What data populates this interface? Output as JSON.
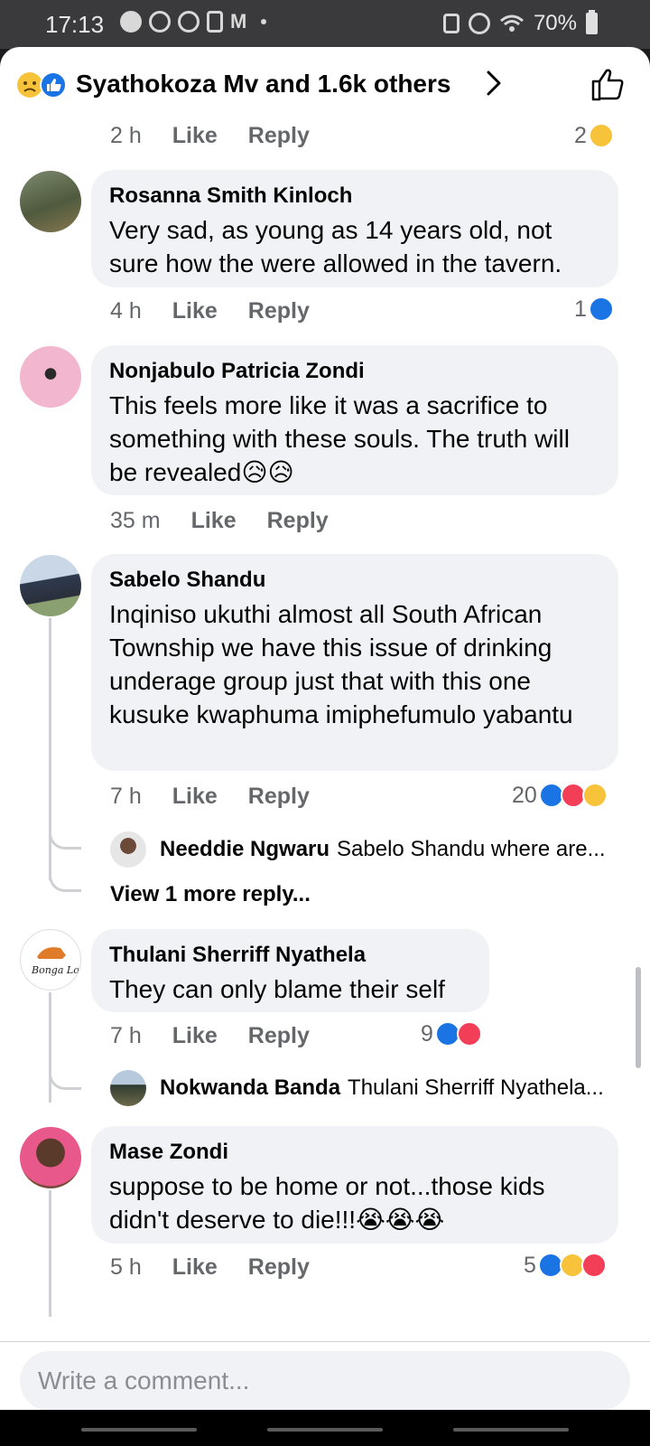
{
  "status_bar": {
    "time": "17:13",
    "battery": "70%"
  },
  "header": {
    "title": "Syathokoza Mv and 1.6k others"
  },
  "top_meta": {
    "time": "2 h",
    "like": "Like",
    "reply": "Reply",
    "reaction_count": "2"
  },
  "comments": [
    {
      "name": "Rosanna Smith Kinloch",
      "text": "Very sad, as young as 14 years old, not sure how the were allowed in the tavern.",
      "time": "4 h",
      "like": "Like",
      "reply": "Reply",
      "reaction_count": "1"
    },
    {
      "name": "Nonjabulo Patricia Zondi",
      "text": "This feels more like it was a sacrifice to something with these souls. The truth will be revealed😥😥",
      "time": "35 m",
      "like": "Like",
      "reply": "Reply"
    },
    {
      "name": "Sabelo Shandu",
      "text": "Inqiniso ukuthi almost all South African Township we have this issue of drinking underage group just that with this one kusuke kwaphuma imiphefumulo yabantu",
      "time": "7 h",
      "like": "Like",
      "reply": "Reply",
      "reaction_count": "20",
      "reply_preview": {
        "name": "Needdie Ngwaru",
        "text": "Sabelo Shandu where are..."
      },
      "view_more": "View 1 more reply..."
    },
    {
      "name": "Thulani Sherriff Nyathela",
      "text": "They can only blame their self",
      "time": "7 h",
      "like": "Like",
      "reply": "Reply",
      "reaction_count": "9",
      "reply_preview": {
        "name": "Nokwanda Banda",
        "text": "Thulani Sherriff Nyathela..."
      }
    },
    {
      "name": "Mase Zondi",
      "text": "suppose to be home or not...those kids didn't deserve to die!!!😭😭😭",
      "time": "5 h",
      "like": "Like",
      "reply": "Reply",
      "reaction_count": "5"
    }
  ],
  "composer": {
    "placeholder": "Write a comment..."
  },
  "colors": {
    "like_blue": "#1b74e4",
    "love_red": "#f33e58",
    "sad_yellow": "#f7c33b",
    "bubble_bg": "#f0f2f5",
    "meta_gray": "#65676b"
  },
  "icons": {
    "header_reactions": [
      "sad-emoji-icon",
      "like-icon"
    ],
    "header_right": "thumbs-up-outline-icon",
    "header_chevron": "chevron-right-icon"
  }
}
